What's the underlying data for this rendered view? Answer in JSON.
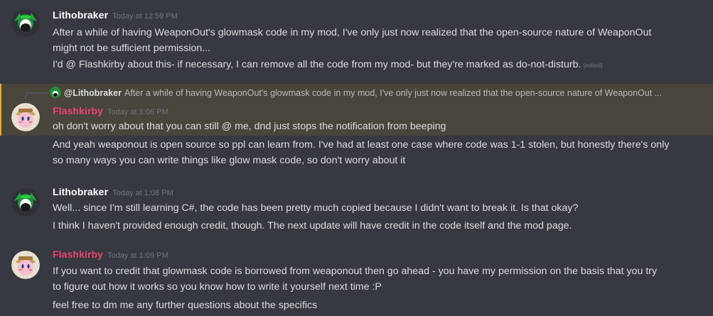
{
  "messages": [
    {
      "author": "Lithobraker",
      "timestamp": "Today at 12:59 PM",
      "lines": [
        "After a while of having WeaponOut's glowmask code in my mod, I've only just now realized that the open-source nature of WeaponOut",
        "might not be sufficient permission...",
        "I'd @ Flashkirby about this- if necessary, I can remove all the code from my mod- but they're marked as do-not-disturb."
      ],
      "edited_label": "(edited)"
    },
    {
      "reply": {
        "author": "@Lithobraker",
        "text": "After a while of having WeaponOut's glowmask code in my mod, I've only just now realized that the open-source nature of WeaponOut ..."
      },
      "author": "Flashkirby",
      "timestamp": "Today at 1:06 PM",
      "lines": [
        "oh don't worry about that you can still @ me, dnd just stops the notification from beeping",
        "And yeah weaponout is open source so ppl can learn from. I've had at least one case where code was 1-1 stolen, but honestly there's only",
        "so many ways you can write things like glow mask code, so don't worry about it"
      ]
    },
    {
      "author": "Lithobraker",
      "timestamp": "Today at 1:08 PM",
      "lines": [
        "Well... since I'm still learning C#, the code has been pretty much copied because I didn't want to break it. Is that okay?",
        "I think I haven't provided enough credit, though. The next update will have credit in the code itself and the mod page."
      ]
    },
    {
      "author": "Flashkirby",
      "timestamp": "Today at 1:09 PM",
      "lines": [
        "If you want to credit that glowmask code is borrowed from weaponout then go ahead - you have my permission on the basis that you try",
        "to figure out how it works so you know how to write it yourself next time :P",
        "feel free to dm me any further questions about the specifics"
      ]
    }
  ],
  "colors": {
    "background": "#36393f",
    "mention_highlight": "#49443c",
    "mention_bar": "#faa81a",
    "flashkirby_name": "#e9446f",
    "lithobraker_name": "#ffffff",
    "timestamp": "#72767d"
  }
}
